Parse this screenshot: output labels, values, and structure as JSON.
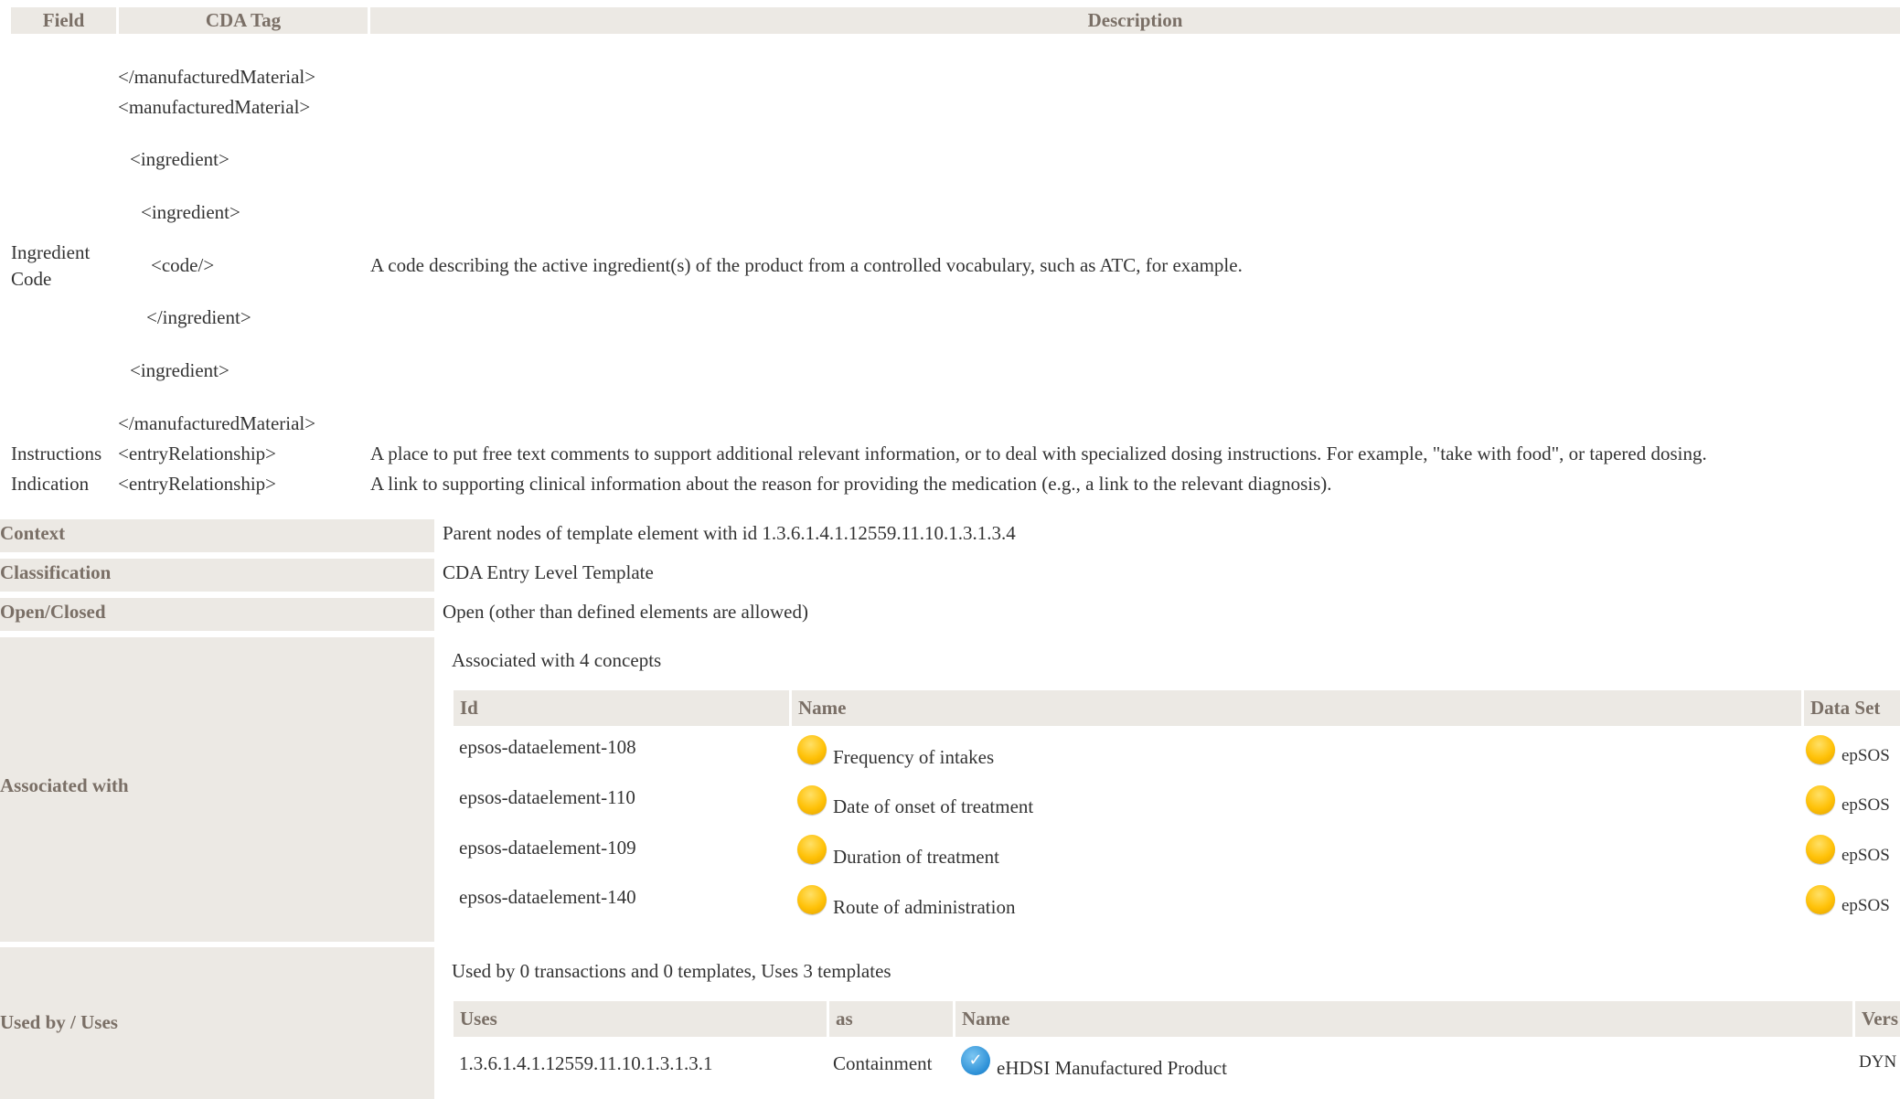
{
  "top_table": {
    "headers": [
      "Field",
      "CDA Tag",
      "Description"
    ],
    "ingredient": {
      "field": "Ingredient Code",
      "tags": [
        "</manufacturedMaterial>",
        "<manufacturedMaterial>",
        "<ingredient>",
        "<ingredient>",
        "<code/>",
        "</ingredient>",
        "<ingredient>",
        "</manufacturedMaterial>"
      ],
      "description": "A code describing the active ingredient(s) of the product from a controlled vocabulary, such as ATC, for example."
    },
    "instructions": {
      "field": "Instructions",
      "tag": "<entryRelationship>",
      "description": "A place to put free text comments to support additional relevant information, or to deal with specialized dosing instructions. For example, \"take with food\", or tapered dosing."
    },
    "indication": {
      "field": "Indication",
      "tag": "<entryRelationship>",
      "description": "A link to supporting clinical information about the reason for providing the medication (e.g., a link to the relevant diagnosis)."
    }
  },
  "meta": {
    "context_label": "Context",
    "context_value": "Parent nodes of template element with id 1.3.6.1.4.1.12559.11.10.1.3.1.3.4",
    "classification_label": "Classification",
    "classification_value": "CDA Entry Level Template",
    "open_label": "Open/Closed",
    "open_value": "Open (other than defined elements are allowed)"
  },
  "associated": {
    "label": "Associated with",
    "summary": "Associated with 4 concepts",
    "headers": [
      "Id",
      "Name",
      "Data Set"
    ],
    "rows": [
      {
        "id": "epsos-dataelement-108",
        "name": "Frequency of intakes",
        "dataset": "epSOS"
      },
      {
        "id": "epsos-dataelement-110",
        "name": "Date of onset of treatment",
        "dataset": "epSOS"
      },
      {
        "id": "epsos-dataelement-109",
        "name": "Duration of treatment",
        "dataset": "epSOS"
      },
      {
        "id": "epsos-dataelement-140",
        "name": "Route of administration",
        "dataset": "epSOS"
      }
    ]
  },
  "used_by": {
    "label": "Used by / Uses",
    "summary": "Used by 0 transactions and 0 templates, Uses 3 templates",
    "headers": [
      "Uses",
      "as",
      "Name",
      "Vers"
    ],
    "rows": [
      {
        "uses": "1.3.6.1.4.1.12559.11.10.1.3.1.3.1",
        "as": "Containment",
        "name": "eHDSI Manufactured Product",
        "version": "DYN"
      }
    ]
  },
  "icons": {
    "concept_status": "yellow-circle-icon",
    "template_status": "blue-check-icon"
  },
  "colors": {
    "header_bg": "#ece9e4",
    "header_text": "#7a6f66",
    "status_yellow": "#ffc107",
    "status_blue": "#2b8fd6"
  }
}
